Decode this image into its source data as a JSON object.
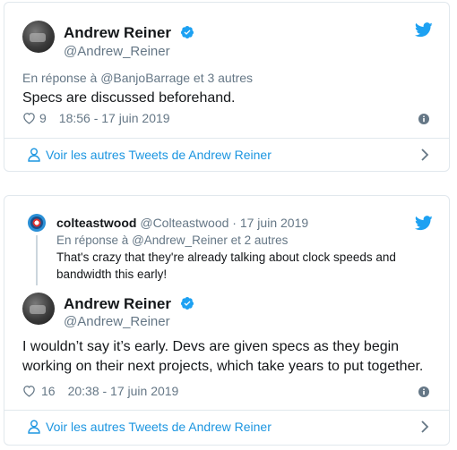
{
  "card1": {
    "author_name": "Andrew Reiner",
    "author_handle": "@Andrew_Reiner",
    "reply_prefix": "En réponse à",
    "reply_mention": "@BanjoBarrage",
    "reply_suffix": "et 3 autres",
    "text": "Specs are discussed beforehand.",
    "likes": "9",
    "timestamp": "18:56 - 17 juin 2019",
    "more_link": "Voir les autres Tweets de Andrew Reiner"
  },
  "card2": {
    "quoted": {
      "name": "colteastwood",
      "handle": "@Colteastwood",
      "date": "· 17 juin 2019",
      "reply_prefix": "En réponse à",
      "reply_mention": "@Andrew_Reiner",
      "reply_suffix": "et 2 autres",
      "text": "That's crazy that they're already talking about clock speeds and bandwidth this early!"
    },
    "author_name": "Andrew Reiner",
    "author_handle": "@Andrew_Reiner",
    "text_line1": "I wouldn’t say it’s early. Devs are given specs as they begin",
    "text_line2": "working on their next projects, which take years to put together.",
    "likes": "16",
    "timestamp": "20:38 - 17 juin 2019",
    "more_link": "Voir les autres Tweets de Andrew Reiner"
  },
  "colors": {
    "twitter_blue": "#1da1f2",
    "link_blue": "#1b95e0",
    "secondary_text": "#657786",
    "border": "#e1e8ed"
  },
  "icons": [
    "twitter-bird-icon",
    "verified-badge-icon",
    "heart-icon",
    "info-icon",
    "person-icon",
    "chevron-right-icon"
  ]
}
